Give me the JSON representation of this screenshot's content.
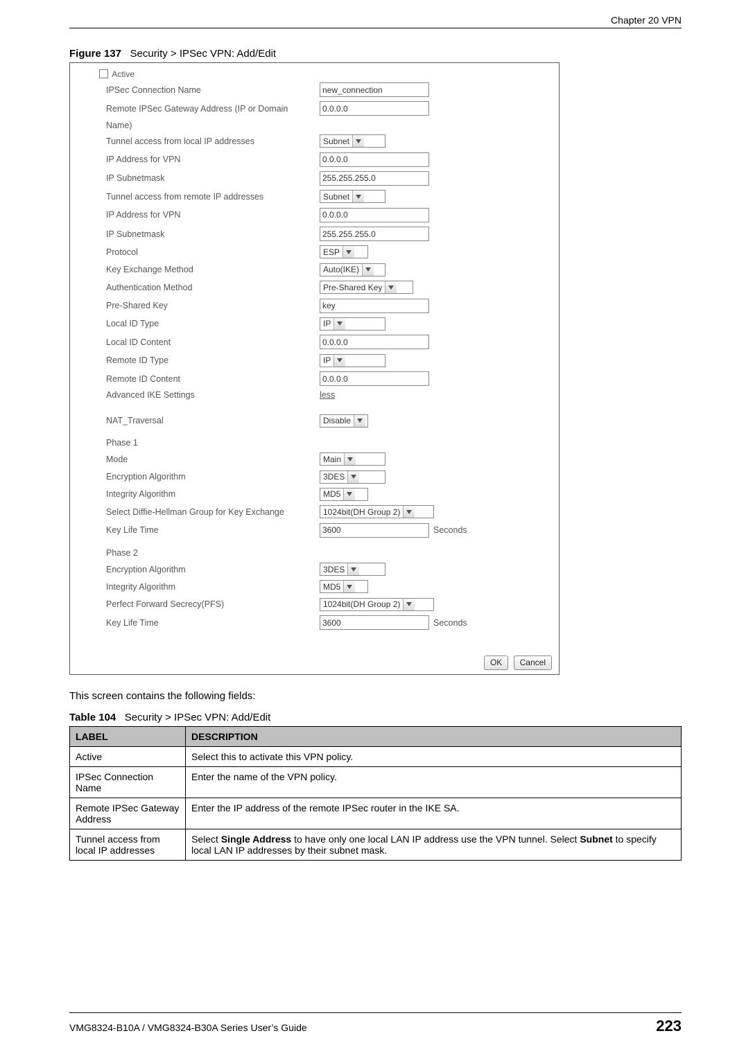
{
  "header": {
    "chapter": "Chapter 20 VPN"
  },
  "figure": {
    "number": "Figure 137",
    "title": "Security > IPSec VPN: Add/Edit"
  },
  "form": {
    "active_label": "Active",
    "rows": [
      {
        "label": "IPSec Connection Name",
        "type": "text",
        "value": "new_connection"
      },
      {
        "label": "Remote IPSec Gateway Address (IP or Domain",
        "type": "text",
        "value": "0.0.0.0"
      },
      {
        "label": "Name)",
        "type": "none"
      },
      {
        "label": "Tunnel access from local IP addresses",
        "type": "select",
        "value": "Subnet",
        "selw": "w-sel-m"
      },
      {
        "label": "IP Address for VPN",
        "type": "text",
        "value": "0.0.0.0"
      },
      {
        "label": "IP Subnetmask",
        "type": "text",
        "value": "255.255.255.0"
      },
      {
        "label": "Tunnel access from remote IP addresses",
        "type": "select",
        "value": "Subnet",
        "selw": "w-sel-m"
      },
      {
        "label": "IP Address for VPN",
        "type": "text",
        "value": "0.0.0.0"
      },
      {
        "label": "IP Subnetmask",
        "type": "text",
        "value": "255.255.255.0"
      },
      {
        "label": "Protocol",
        "type": "select",
        "value": "ESP",
        "selw": "w-sel-s"
      },
      {
        "label": "Key Exchange Method",
        "type": "select",
        "value": "Auto(IKE)",
        "selw": "w-sel-m"
      },
      {
        "label": "Authentication Method",
        "type": "select",
        "value": "Pre-Shared Key",
        "selw": "w-sel-l"
      },
      {
        "label": "Pre-Shared Key",
        "type": "text",
        "value": "key"
      },
      {
        "label": "Local ID Type",
        "type": "select",
        "value": "IP",
        "selw": "w-sel-m"
      },
      {
        "label": "Local ID Content",
        "type": "text",
        "value": "0.0.0.0"
      },
      {
        "label": "Remote ID Type",
        "type": "select",
        "value": "IP",
        "selw": "w-sel-m"
      },
      {
        "label": "Remote ID Content",
        "type": "text",
        "value": "0.0.0.0"
      },
      {
        "label": "Advanced IKE Settings",
        "type": "link",
        "value": "less"
      }
    ],
    "nat": {
      "label": "NAT_Traversal",
      "value": "Disable",
      "selw": "w-sel-s"
    },
    "phase1": {
      "title": "Phase 1",
      "rows": [
        {
          "label": "Mode",
          "type": "select",
          "value": "Main",
          "selw": "w-sel-m"
        },
        {
          "label": "Encryption Algorithm",
          "type": "select",
          "value": "3DES",
          "selw": "w-sel-m"
        },
        {
          "label": "Integrity Algorithm",
          "type": "select",
          "value": "MD5",
          "selw": "w-sel-s"
        },
        {
          "label": "Select Diffie-Hellman Group for Key Exchange",
          "type": "select",
          "value": "1024bit(DH Group 2)",
          "selw": "w-sel-xl"
        },
        {
          "label": "Key Life Time",
          "type": "text_suffix",
          "value": "3600",
          "suffix": "Seconds"
        }
      ]
    },
    "phase2": {
      "title": "Phase 2",
      "rows": [
        {
          "label": "Encryption Algorithm",
          "type": "select",
          "value": "3DES",
          "selw": "w-sel-m"
        },
        {
          "label": "Integrity Algorithm",
          "type": "select",
          "value": "MD5",
          "selw": "w-sel-s"
        },
        {
          "label": "Perfect Forward Secrecy(PFS)",
          "type": "select",
          "value": "1024bit(DH Group 2)",
          "selw": "w-sel-xl"
        },
        {
          "label": "Key Life Time",
          "type": "text_suffix",
          "value": "3600",
          "suffix": "Seconds"
        }
      ]
    },
    "buttons": {
      "ok": "OK",
      "cancel": "Cancel"
    }
  },
  "body_text": "This screen contains the following fields:",
  "table": {
    "number": "Table 104",
    "title": "Security > IPSec VPN: Add/Edit",
    "head": {
      "c1": "LABEL",
      "c2": "DESCRIPTION"
    },
    "rows": [
      {
        "label": "Active",
        "desc": "Select this to activate this VPN policy."
      },
      {
        "label": "IPSec Connection Name",
        "desc": "Enter the name of the VPN policy."
      },
      {
        "label": "Remote IPSec Gateway Address",
        "desc": "Enter the IP address of the remote IPSec router in the IKE SA."
      },
      {
        "label": "Tunnel access from local IP addresses",
        "desc_pre": "Select ",
        "b1": "Single Address",
        "mid": " to have only one local LAN IP address use the VPN tunnel. Select ",
        "b2": "Subnet",
        "desc_post": " to specify local LAN IP addresses by their subnet mask."
      }
    ]
  },
  "footer": {
    "left": "VMG8324-B10A / VMG8324-B30A Series User’s Guide",
    "page": "223"
  }
}
